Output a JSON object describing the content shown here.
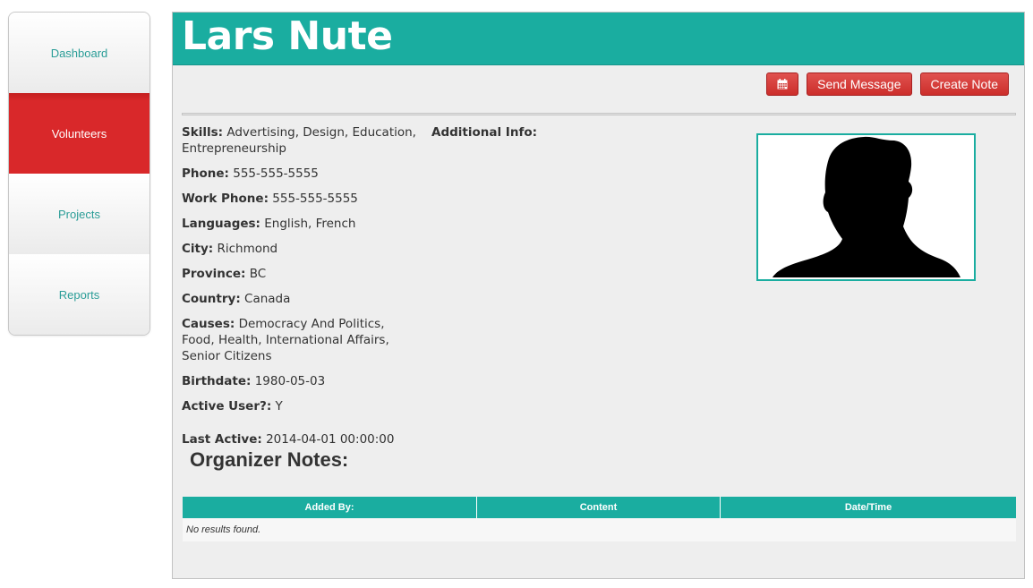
{
  "sidebar": {
    "items": [
      {
        "label": "Dashboard"
      },
      {
        "label": "Volunteers"
      },
      {
        "label": "Projects"
      },
      {
        "label": "Reports"
      }
    ],
    "active": "Volunteers"
  },
  "profile": {
    "name": "Lars Nute",
    "additional_info_label": "Additional Info:",
    "fields": {
      "skills": {
        "label": "Skills:",
        "value": "Advertising, Design, Education, Entrepreneurship"
      },
      "phone": {
        "label": "Phone:",
        "value": "555-555-5555"
      },
      "work_phone": {
        "label": "Work Phone:",
        "value": "555-555-5555"
      },
      "languages": {
        "label": "Languages:",
        "value": "English, French"
      },
      "city": {
        "label": "City:",
        "value": "Richmond"
      },
      "province": {
        "label": "Province:",
        "value": "BC"
      },
      "country": {
        "label": "Country:",
        "value": "Canada"
      },
      "causes": {
        "label": "Causes:",
        "value": "Democracy And Politics, Food, Health, International Affairs, Senior Citizens"
      },
      "birthdate": {
        "label": "Birthdate:",
        "value": "1980-05-03"
      },
      "active_user": {
        "label": "Active User?:",
        "value": "Y"
      },
      "last_active": {
        "label": "Last Active:",
        "value": "2014-04-01 00:00:00"
      }
    },
    "photo_icon": "person-silhouette-icon"
  },
  "toolbar": {
    "calendar_icon": "calendar-icon",
    "send_message_label": "Send Message",
    "create_note_label": "Create Note"
  },
  "notes": {
    "title": "Organizer Notes:",
    "columns": [
      "Added By:",
      "Content",
      "Date/Time"
    ],
    "empty_text": "No results found."
  },
  "colors": {
    "accent": "#1aada0",
    "danger": "#d9282a",
    "link": "#2a9d97"
  }
}
